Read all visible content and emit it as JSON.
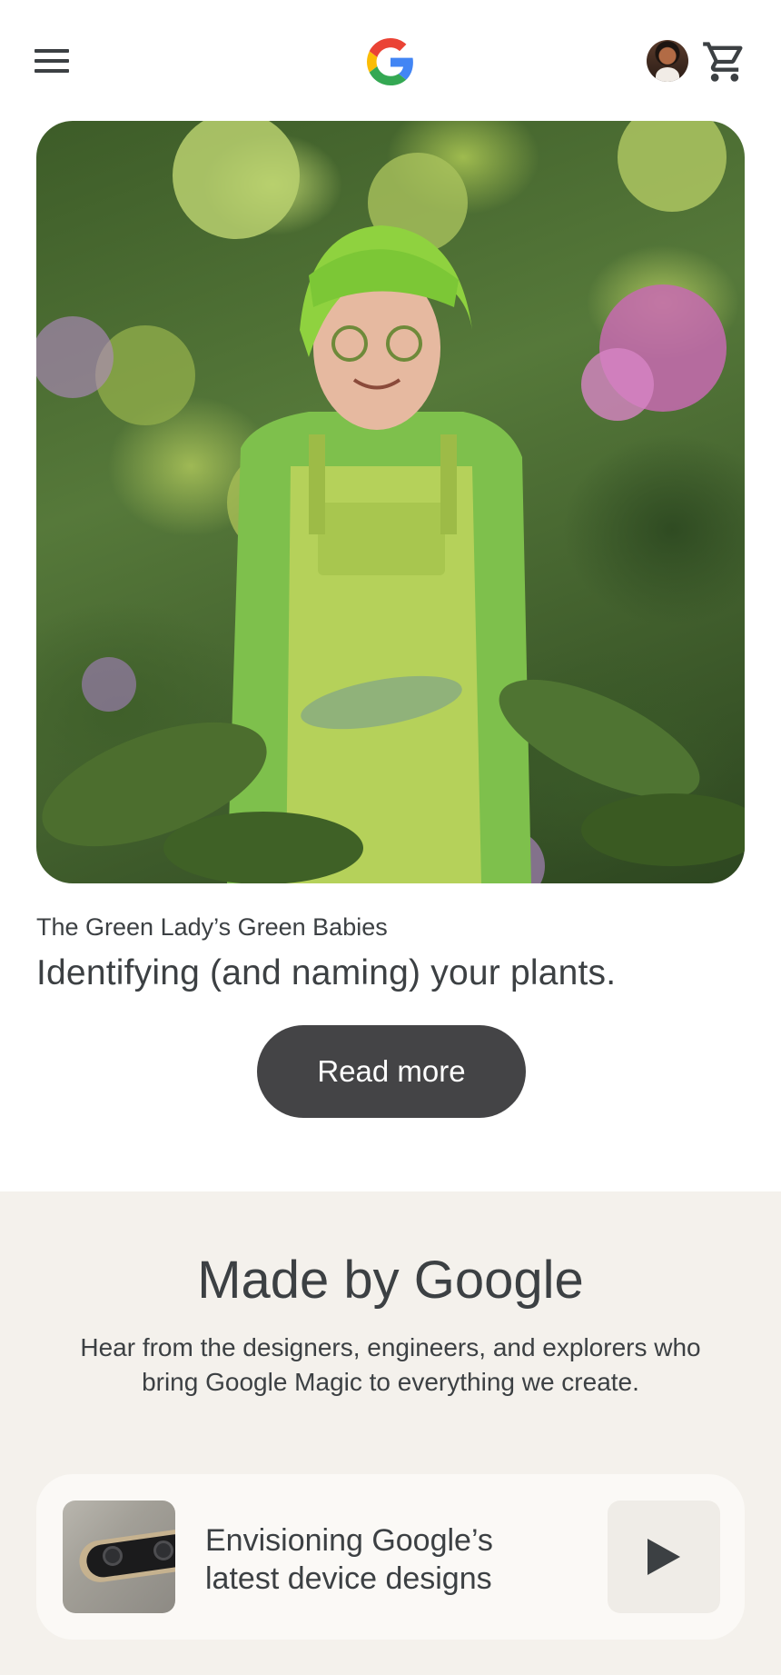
{
  "header": {
    "menu_icon": "hamburger-menu-icon",
    "logo_icon": "google-g-logo",
    "avatar_icon": "user-avatar",
    "cart_icon": "shopping-cart-icon"
  },
  "hero": {
    "image_alt": "Woman with green hair in green overalls among plants and flowers",
    "eyebrow": "The Green Lady’s Green Babies",
    "headline": "Identifying (and naming) your plants.",
    "cta_label": "Read more"
  },
  "made_by_google": {
    "title": "Made by Google",
    "description": "Hear from the designers, engineers, and explorers who bring Google Magic to everything we create.",
    "video_card": {
      "title": "Envisioning Google’s latest device designs",
      "play_icon": "play-icon"
    }
  },
  "colors": {
    "text": "#3c4043",
    "button_bg": "#444446",
    "section_bg": "#f4f1ec",
    "card_bg": "#fbf9f6"
  }
}
